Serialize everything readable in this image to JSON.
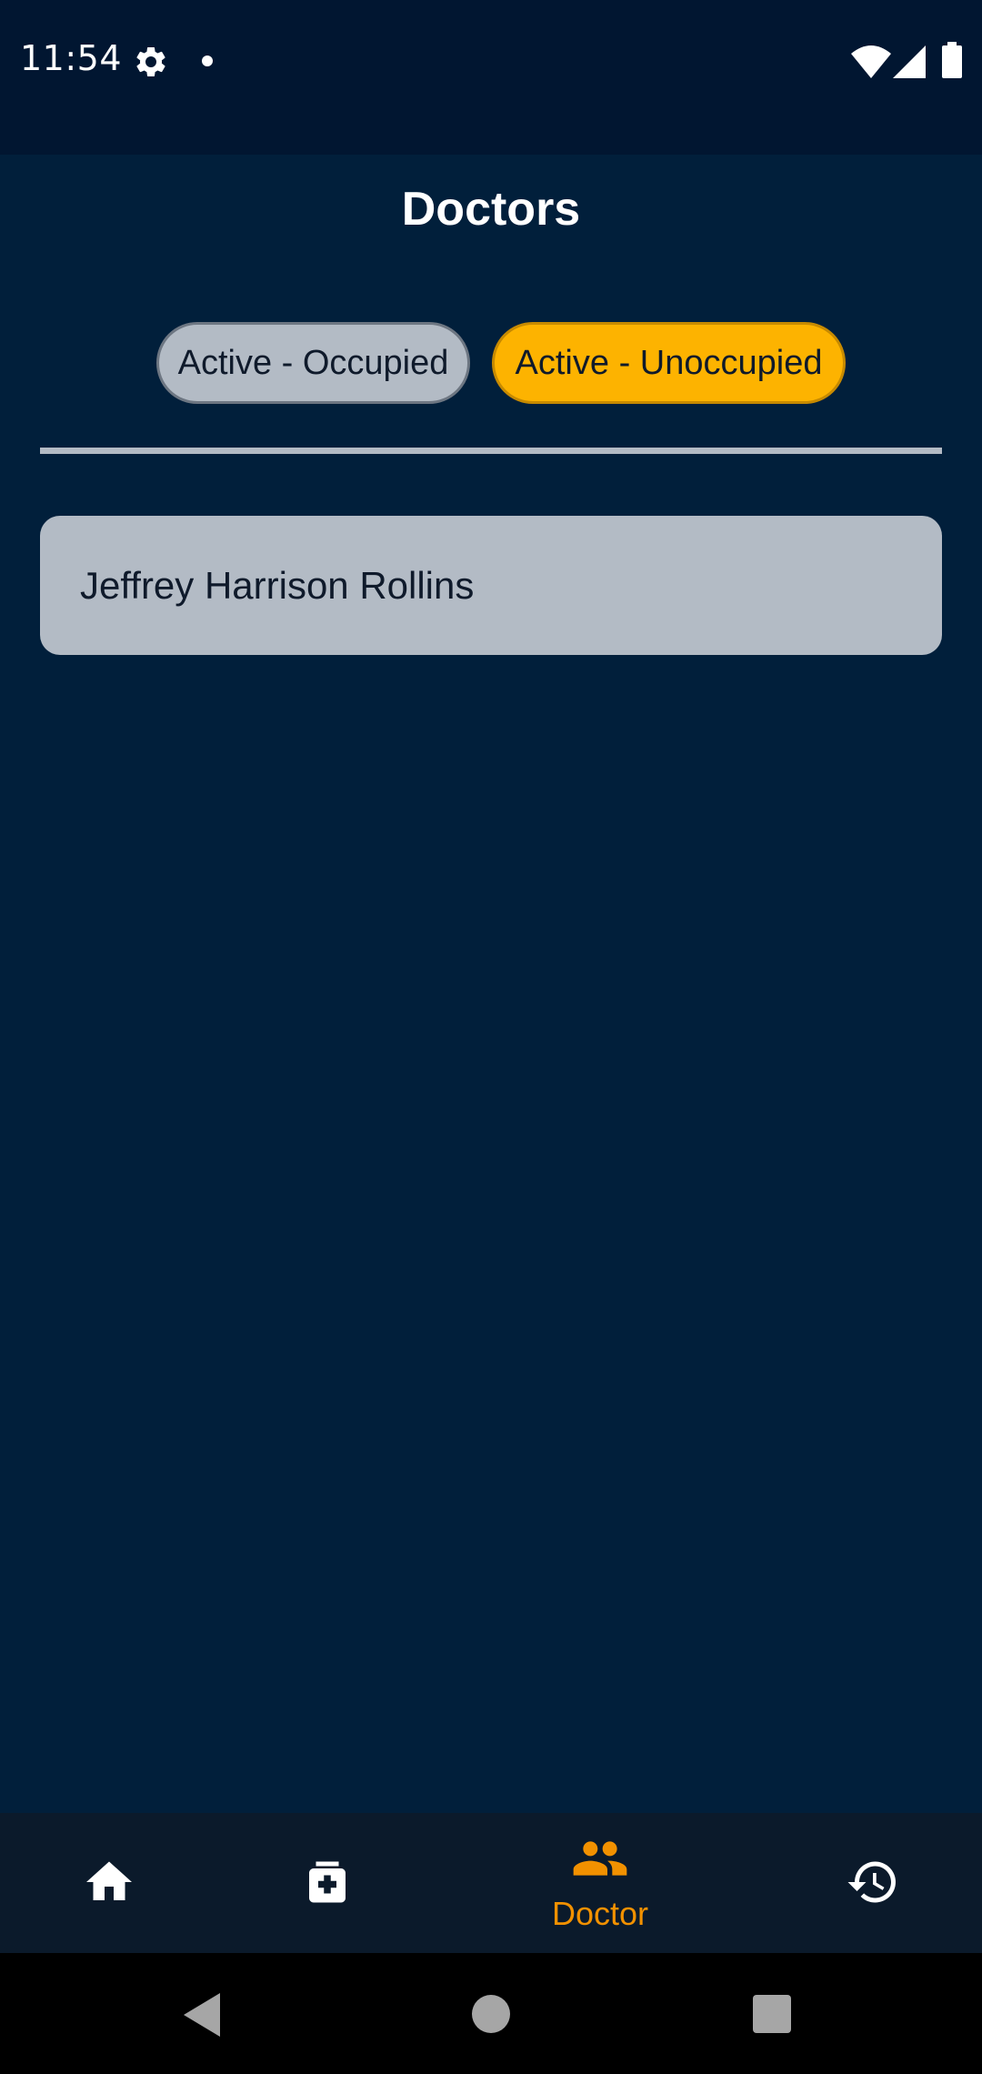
{
  "status_bar": {
    "time": "11:54",
    "icons": [
      "gear-icon",
      "notification-dot-icon",
      "wifi-icon",
      "signal-icon",
      "battery-icon"
    ]
  },
  "header": {
    "title": "Doctors"
  },
  "filters": {
    "chips": [
      {
        "label": "Active - Occupied",
        "selected": false,
        "color": "#b3bbc5"
      },
      {
        "label": "Active - Unoccupied",
        "selected": true,
        "color": "#fdb300"
      }
    ]
  },
  "doctors": [
    {
      "name": "Jeffrey Harrison Rollins"
    }
  ],
  "bottom_nav": {
    "items": [
      {
        "icon": "home-icon",
        "label": "",
        "active": false
      },
      {
        "icon": "medicine-icon",
        "label": "",
        "active": false
      },
      {
        "icon": "doctors-icon",
        "label": "Doctor",
        "active": true
      },
      {
        "icon": "history-icon",
        "label": "",
        "active": false
      }
    ],
    "active_color": "#f29100"
  },
  "colors": {
    "background": "#011f3b",
    "accent": "#fdb300"
  }
}
